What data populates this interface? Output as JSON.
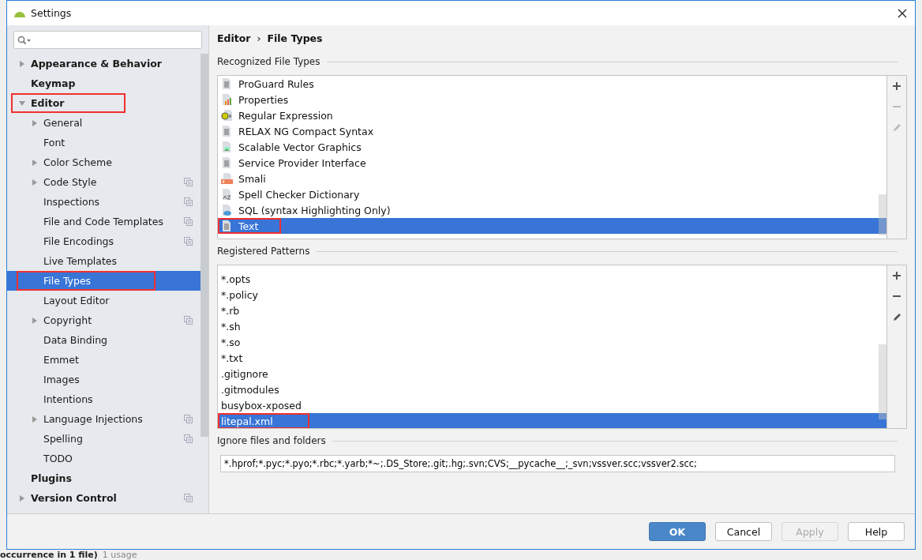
{
  "window": {
    "title": "Settings"
  },
  "sidebar": {
    "items": [
      {
        "label": "Appearance & Behavior",
        "expanded": false
      },
      {
        "label": "Keymap"
      },
      {
        "label": "Editor",
        "expanded": true,
        "annotated": true,
        "children": [
          {
            "label": "General",
            "expanded": false
          },
          {
            "label": "Font"
          },
          {
            "label": "Color Scheme",
            "expanded": false
          },
          {
            "label": "Code Style",
            "expanded": false,
            "shared": true
          },
          {
            "label": "Inspections",
            "shared": true
          },
          {
            "label": "File and Code Templates",
            "shared": true
          },
          {
            "label": "File Encodings",
            "shared": true
          },
          {
            "label": "Live Templates"
          },
          {
            "label": "File Types",
            "selected": true,
            "annotated": true
          },
          {
            "label": "Layout Editor"
          },
          {
            "label": "Copyright",
            "expanded": false,
            "shared": true
          },
          {
            "label": "Data Binding"
          },
          {
            "label": "Emmet"
          },
          {
            "label": "Images"
          },
          {
            "label": "Intentions"
          },
          {
            "label": "Language Injections",
            "expanded": false,
            "shared": true
          },
          {
            "label": "Spelling",
            "shared": true
          },
          {
            "label": "TODO"
          }
        ]
      },
      {
        "label": "Plugins"
      },
      {
        "label": "Version Control",
        "expanded": false,
        "shared": true
      }
    ]
  },
  "breadcrumb": [
    "Editor",
    "File Types"
  ],
  "breadcrumb_separator": "›",
  "recognized": {
    "title": "Recognized File Types",
    "items": [
      {
        "label": "ProGuard Rules",
        "kind": "doc",
        "selected": false
      },
      {
        "label": "Properties",
        "kind": "properties",
        "selected": false
      },
      {
        "label": "Regular Expression",
        "kind": "regex",
        "selected": false
      },
      {
        "label": "RELAX NG Compact Syntax",
        "kind": "doc",
        "selected": false
      },
      {
        "label": "Scalable Vector Graphics",
        "kind": "image",
        "selected": false
      },
      {
        "label": "Service Provider Interface",
        "kind": "doc",
        "selected": false
      },
      {
        "label": "Smali",
        "kind": "smali",
        "selected": false
      },
      {
        "label": "Spell Checker Dictionary",
        "kind": "dictionary",
        "selected": false
      },
      {
        "label": "SQL (syntax Highlighting Only)",
        "kind": "sql",
        "selected": false
      },
      {
        "label": "Text",
        "kind": "doc",
        "selected": true,
        "annotated": true
      }
    ],
    "tools": [
      {
        "kind": "add",
        "disabled": false
      },
      {
        "kind": "remove",
        "disabled": true
      },
      {
        "kind": "edit",
        "disabled": true
      }
    ]
  },
  "patterns": {
    "title": "Registered Patterns",
    "items": [
      {
        "label": "*.opts",
        "selected": false
      },
      {
        "label": "*.policy",
        "selected": false
      },
      {
        "label": "*.rb",
        "selected": false
      },
      {
        "label": "*.sh",
        "selected": false
      },
      {
        "label": "*.so",
        "selected": false
      },
      {
        "label": "*.txt",
        "selected": false
      },
      {
        "label": ".gitignore",
        "selected": false
      },
      {
        "label": ".gitmodules",
        "selected": false
      },
      {
        "label": "busybox-xposed",
        "selected": false
      },
      {
        "label": "litepal.xml",
        "selected": true,
        "annotated": true
      }
    ],
    "tools": [
      {
        "kind": "add",
        "disabled": false
      },
      {
        "kind": "remove",
        "disabled": false
      },
      {
        "kind": "edit",
        "disabled": false
      }
    ]
  },
  "ignore": {
    "title": "Ignore files and folders",
    "value": "*.hprof;*.pyc;*.pyo;*.rbc;*.yarb;*~;.DS_Store;.git;.hg;.svn;CVS;__pycache__;_svn;vssver.scc;vssver2.scc;"
  },
  "buttons": [
    {
      "label": "OK",
      "kind": "default",
      "disabled": false
    },
    {
      "label": "Cancel",
      "kind": "normal",
      "disabled": false
    },
    {
      "label": "Apply",
      "kind": "normal",
      "disabled": true
    },
    {
      "label": "Help",
      "kind": "normal",
      "disabled": false
    }
  ],
  "background_status": {
    "text": "occurrence in 1 file)",
    "hint": "1 usage"
  }
}
